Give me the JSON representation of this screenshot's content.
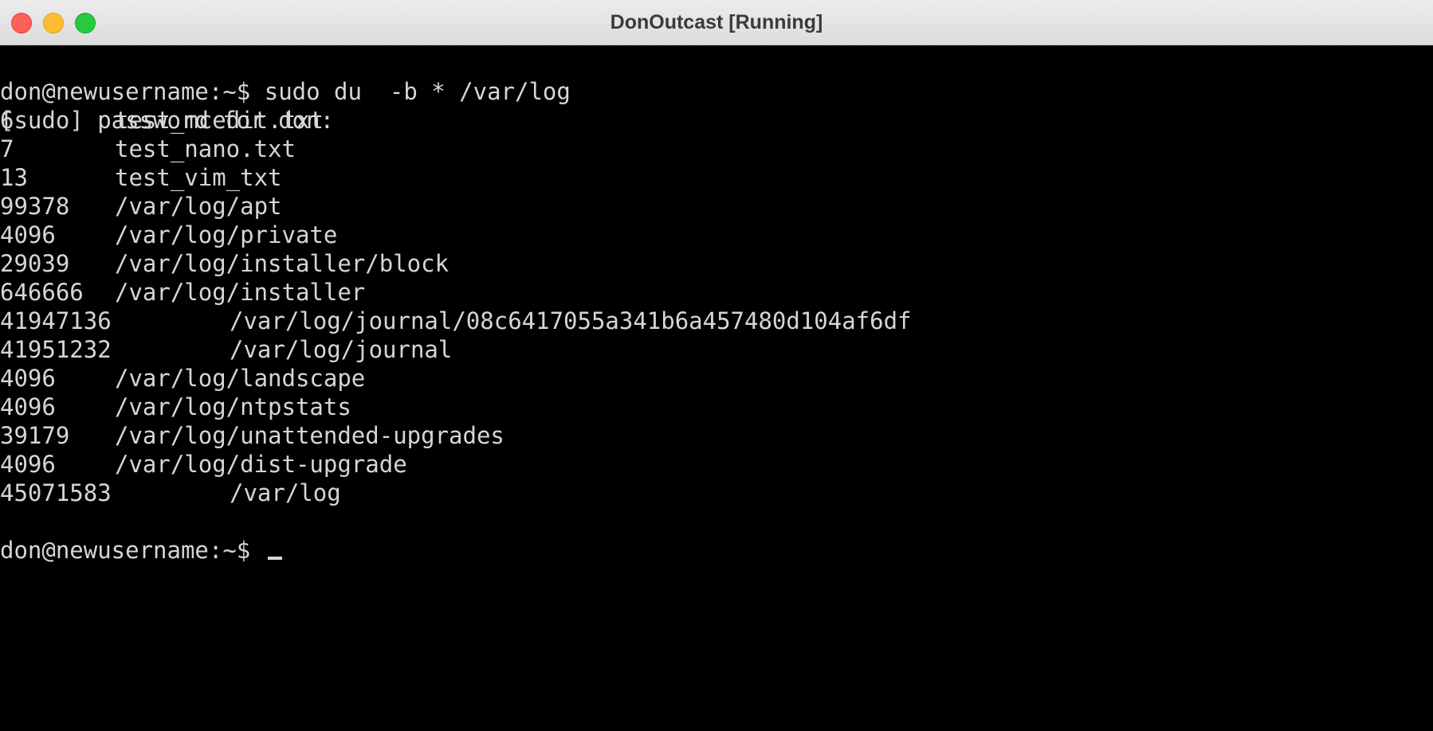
{
  "window": {
    "title": "DonOutcast [Running]"
  },
  "terminal": {
    "command_line": "don@newusername:~$ sudo du  -b * /var/log",
    "sudo_prompt": "[sudo] password for don:",
    "rows": [
      {
        "size": "6",
        "path": "test_mcedit.txt",
        "col": 1
      },
      {
        "size": "7",
        "path": "test_nano.txt",
        "col": 1
      },
      {
        "size": "13",
        "path": "test_vim_txt",
        "col": 1
      },
      {
        "size": "99378",
        "path": "/var/log/apt",
        "col": 1
      },
      {
        "size": "4096",
        "path": "/var/log/private",
        "col": 1
      },
      {
        "size": "29039",
        "path": "/var/log/installer/block",
        "col": 1
      },
      {
        "size": "646666",
        "path": "/var/log/installer",
        "col": 1
      },
      {
        "size": "41947136",
        "path": "/var/log/journal/08c6417055a341b6a457480d104af6df",
        "col": 2
      },
      {
        "size": "41951232",
        "path": "/var/log/journal",
        "col": 2
      },
      {
        "size": "4096",
        "path": "/var/log/landscape",
        "col": 1
      },
      {
        "size": "4096",
        "path": "/var/log/ntpstats",
        "col": 1
      },
      {
        "size": "39179",
        "path": "/var/log/unattended-upgrades",
        "col": 1
      },
      {
        "size": "4096",
        "path": "/var/log/dist-upgrade",
        "col": 1
      },
      {
        "size": "45071583",
        "path": "/var/log",
        "col": 2
      }
    ],
    "prompt": "don@newusername:~$"
  }
}
